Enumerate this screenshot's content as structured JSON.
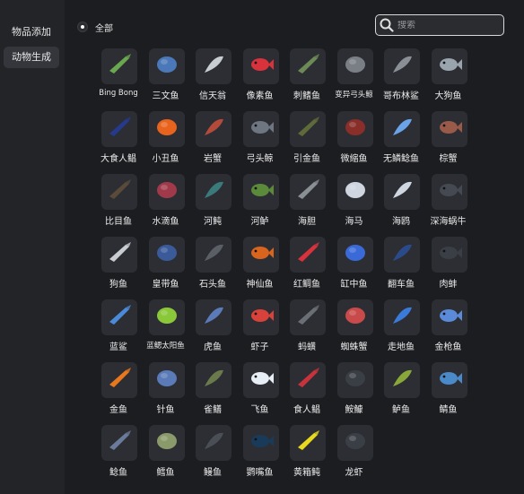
{
  "sidebar": {
    "items": [
      {
        "label": "物品添加",
        "active": false
      },
      {
        "label": "动物生成",
        "active": true
      }
    ]
  },
  "filter": {
    "label": "全部",
    "selected": true
  },
  "search": {
    "placeholder": "搜索",
    "value": ""
  },
  "grid": {
    "items": [
      {
        "label": "Bing Bong",
        "icon": "bing-bong-icon",
        "color": "#6aa84f"
      },
      {
        "label": "三文鱼",
        "icon": "salmon-icon",
        "color": "#4a78b8"
      },
      {
        "label": "信天翁",
        "icon": "albatross-icon",
        "color": "#c8cdd2"
      },
      {
        "label": "像素鱼",
        "icon": "pixel-fish-icon",
        "color": "#d8323c"
      },
      {
        "label": "刺鳍鱼",
        "icon": "spinefish-icon",
        "color": "#6b8a55"
      },
      {
        "label": "变异弓头鲸",
        "icon": "mutant-bowhead-icon",
        "color": "#7a7f86"
      },
      {
        "label": "哥布林鲨",
        "icon": "goblin-shark-icon",
        "color": "#8a8f96"
      },
      {
        "label": "大狗鱼",
        "icon": "pike-icon",
        "color": "#9aa4ad"
      },
      {
        "label": "大食人鲳",
        "icon": "piranha-icon",
        "color": "#253a8a"
      },
      {
        "label": "小丑鱼",
        "icon": "clownfish-icon",
        "color": "#e8641e"
      },
      {
        "label": "岩蟹",
        "icon": "rock-crab-icon",
        "color": "#b34a3a"
      },
      {
        "label": "弓头鲸",
        "icon": "bowhead-whale-icon",
        "color": "#6e7681"
      },
      {
        "label": "引金鱼",
        "icon": "triggerfish-icon",
        "color": "#5e6a3a"
      },
      {
        "label": "微缩鱼",
        "icon": "mini-fish-icon",
        "color": "#8a2e2a"
      },
      {
        "label": "无鳞鲶鱼",
        "icon": "scaleless-catfish-icon",
        "color": "#6aa3e8"
      },
      {
        "label": "棕蟹",
        "icon": "brown-crab-icon",
        "color": "#9a5a4a"
      },
      {
        "label": "比目鱼",
        "icon": "flounder-icon",
        "color": "#5a4a3a"
      },
      {
        "label": "水滴鱼",
        "icon": "blobfish-icon",
        "color": "#a03a4a"
      },
      {
        "label": "河鲀",
        "icon": "pufferfish-icon",
        "color": "#3a7a7a"
      },
      {
        "label": "河鲈",
        "icon": "perch-icon",
        "color": "#5a8a3a"
      },
      {
        "label": "海胆",
        "icon": "sea-urchin-icon",
        "color": "#8a8f96"
      },
      {
        "label": "海马",
        "icon": "seahorse-icon",
        "color": "#cfd6e0"
      },
      {
        "label": "海鸥",
        "icon": "seagull-icon",
        "color": "#cfd6e0"
      },
      {
        "label": "深海蜗牛",
        "icon": "deep-sea-snail-icon",
        "color": "#454a52"
      },
      {
        "label": "狗鱼",
        "icon": "dogfish-icon",
        "color": "#c8cdd2"
      },
      {
        "label": "皇带鱼",
        "icon": "oarfish-icon",
        "color": "#3a5a9a"
      },
      {
        "label": "石头鱼",
        "icon": "stonefish-icon",
        "color": "#5a5f66"
      },
      {
        "label": "神仙鱼",
        "icon": "angelfish-icon",
        "color": "#d8641e"
      },
      {
        "label": "红鲷鱼",
        "icon": "red-snapper-icon",
        "color": "#d8323c"
      },
      {
        "label": "缸中鱼",
        "icon": "fish-in-tank-icon",
        "color": "#3a6ad8"
      },
      {
        "label": "翻车鱼",
        "icon": "sunfish-icon",
        "color": "#2a4a8a"
      },
      {
        "label": "肉蚌",
        "icon": "clam-icon",
        "color": "#3a3f46"
      },
      {
        "label": "蓝鲨",
        "icon": "blue-shark-icon",
        "color": "#4a8ad8"
      },
      {
        "label": "蓝鳃太阳鱼",
        "icon": "bluegill-icon",
        "color": "#8ac83a"
      },
      {
        "label": "虎鱼",
        "icon": "tiger-fish-icon",
        "color": "#5a7ab8"
      },
      {
        "label": "虾子",
        "icon": "shrimp-icon",
        "color": "#d8423a"
      },
      {
        "label": "蚂蟥",
        "icon": "leech-icon",
        "color": "#6a6f76"
      },
      {
        "label": "蜘蛛蟹",
        "icon": "spider-crab-icon",
        "color": "#c84a4a"
      },
      {
        "label": "走地鱼",
        "icon": "walking-fish-icon",
        "color": "#3a7ad8"
      },
      {
        "label": "金枪鱼",
        "icon": "tuna-icon",
        "color": "#5a8ad8"
      },
      {
        "label": "金鱼",
        "icon": "goldfish-icon",
        "color": "#e8781e"
      },
      {
        "label": "针鱼",
        "icon": "needlefish-icon",
        "color": "#5a7ab8"
      },
      {
        "label": "雀鳝",
        "icon": "gar-icon",
        "color": "#6a7a4a"
      },
      {
        "label": "飞鱼",
        "icon": "flying-fish-icon",
        "color": "#e8eef5"
      },
      {
        "label": "食人鲳",
        "icon": "small-piranha-icon",
        "color": "#c8323c"
      },
      {
        "label": "鮟鱇",
        "icon": "anglerfish-icon",
        "color": "#3a3f46"
      },
      {
        "label": "鲈鱼",
        "icon": "bass-icon",
        "color": "#8aa83a"
      },
      {
        "label": "鲭鱼",
        "icon": "mackerel-icon",
        "color": "#4a8ac8"
      },
      {
        "label": "鲶鱼",
        "icon": "catfish-icon",
        "color": "#6a7a9a"
      },
      {
        "label": "鳕鱼",
        "icon": "cod-icon",
        "color": "#8a9a6a"
      },
      {
        "label": "鳗鱼",
        "icon": "eel-icon",
        "color": "#4a4f56"
      },
      {
        "label": "鹦嘴鱼",
        "icon": "parrotfish-icon",
        "color": "#1a3a5a"
      },
      {
        "label": "黄箱鲀",
        "icon": "yellow-boxfish-icon",
        "color": "#e8d81e"
      },
      {
        "label": "龙虾",
        "icon": "lobster-icon",
        "color": "#3a3f46"
      }
    ]
  }
}
